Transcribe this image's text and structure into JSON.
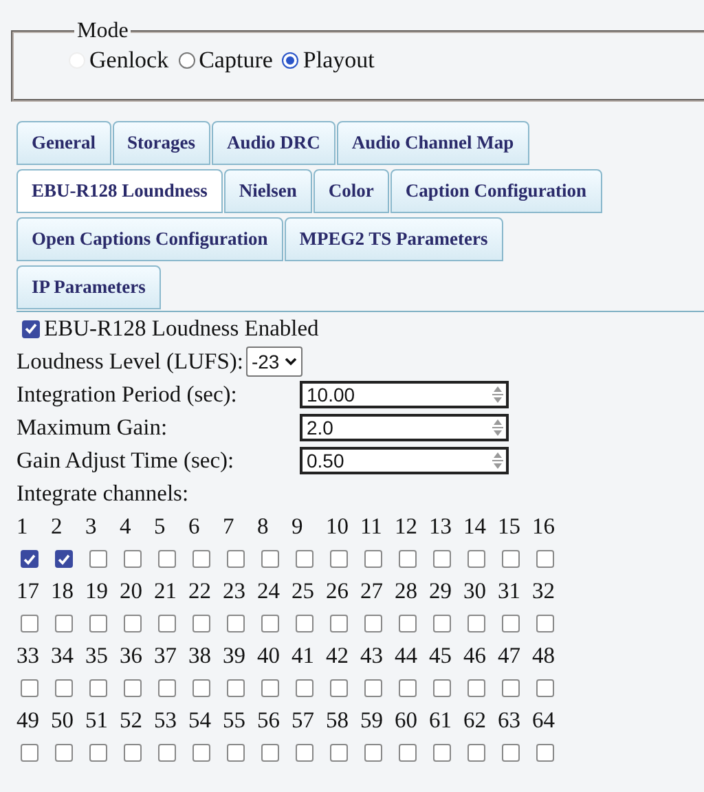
{
  "mode": {
    "legend": "Mode",
    "options": [
      {
        "label": "Genlock",
        "selected": false,
        "disabled": true
      },
      {
        "label": "Capture",
        "selected": false,
        "disabled": false
      },
      {
        "label": "Playout",
        "selected": true,
        "disabled": false
      }
    ]
  },
  "tab_rows": [
    [
      {
        "label": "General",
        "selected": false
      },
      {
        "label": "Storages",
        "selected": false
      },
      {
        "label": "Audio DRC",
        "selected": false
      },
      {
        "label": "Audio Channel Map",
        "selected": false
      }
    ],
    [
      {
        "label": "EBU-R128 Loundness",
        "selected": true
      },
      {
        "label": "Nielsen",
        "selected": false
      },
      {
        "label": "Color",
        "selected": false
      },
      {
        "label": "Caption Configuration",
        "selected": false
      }
    ],
    [
      {
        "label": "Open Captions Configuration",
        "selected": false
      },
      {
        "label": "MPEG2 TS Parameters",
        "selected": false
      }
    ],
    [
      {
        "label": "IP Parameters",
        "selected": false
      }
    ]
  ],
  "enabled": {
    "label": "EBU-R128 Loudness Enabled",
    "checked": true
  },
  "fields": [
    {
      "kind": "select",
      "label": "Loudness Level (LUFS):",
      "value": "-23"
    },
    {
      "kind": "spin",
      "label": "Integration Period (sec):",
      "value": "10.00"
    },
    {
      "kind": "spin",
      "label": "Maximum Gain:",
      "value": "2.0"
    },
    {
      "kind": "spin",
      "label": "Gain Adjust Time (sec):",
      "value": "0.50"
    }
  ],
  "channels_label": "Integrate channels:",
  "channels": [
    {
      "label": "1",
      "checked": true
    },
    {
      "label": "2",
      "checked": true
    },
    {
      "label": "3",
      "checked": false
    },
    {
      "label": "4",
      "checked": false
    },
    {
      "label": "5",
      "checked": false
    },
    {
      "label": "6",
      "checked": false
    },
    {
      "label": "7",
      "checked": false
    },
    {
      "label": "8",
      "checked": false
    },
    {
      "label": "9",
      "checked": false
    },
    {
      "label": "10",
      "checked": false
    },
    {
      "label": "11",
      "checked": false
    },
    {
      "label": "12",
      "checked": false
    },
    {
      "label": "13",
      "checked": false
    },
    {
      "label": "14",
      "checked": false
    },
    {
      "label": "15",
      "checked": false
    },
    {
      "label": "16",
      "checked": false
    },
    {
      "label": "17",
      "checked": false
    },
    {
      "label": "18",
      "checked": false
    },
    {
      "label": "19",
      "checked": false
    },
    {
      "label": "20",
      "checked": false
    },
    {
      "label": "21",
      "checked": false
    },
    {
      "label": "22",
      "checked": false
    },
    {
      "label": "23",
      "checked": false
    },
    {
      "label": "24",
      "checked": false
    },
    {
      "label": "25",
      "checked": false
    },
    {
      "label": "26",
      "checked": false
    },
    {
      "label": "27",
      "checked": false
    },
    {
      "label": "28",
      "checked": false
    },
    {
      "label": "29",
      "checked": false
    },
    {
      "label": "30",
      "checked": false
    },
    {
      "label": "31",
      "checked": false
    },
    {
      "label": "32",
      "checked": false
    },
    {
      "label": "33",
      "checked": false
    },
    {
      "label": "34",
      "checked": false
    },
    {
      "label": "35",
      "checked": false
    },
    {
      "label": "36",
      "checked": false
    },
    {
      "label": "37",
      "checked": false
    },
    {
      "label": "38",
      "checked": false
    },
    {
      "label": "39",
      "checked": false
    },
    {
      "label": "40",
      "checked": false
    },
    {
      "label": "41",
      "checked": false
    },
    {
      "label": "42",
      "checked": false
    },
    {
      "label": "43",
      "checked": false
    },
    {
      "label": "44",
      "checked": false
    },
    {
      "label": "45",
      "checked": false
    },
    {
      "label": "46",
      "checked": false
    },
    {
      "label": "47",
      "checked": false
    },
    {
      "label": "48",
      "checked": false
    },
    {
      "label": "49",
      "checked": false
    },
    {
      "label": "50",
      "checked": false
    },
    {
      "label": "51",
      "checked": false
    },
    {
      "label": "52",
      "checked": false
    },
    {
      "label": "53",
      "checked": false
    },
    {
      "label": "54",
      "checked": false
    },
    {
      "label": "55",
      "checked": false
    },
    {
      "label": "56",
      "checked": false
    },
    {
      "label": "57",
      "checked": false
    },
    {
      "label": "58",
      "checked": false
    },
    {
      "label": "59",
      "checked": false
    },
    {
      "label": "60",
      "checked": false
    },
    {
      "label": "61",
      "checked": false
    },
    {
      "label": "62",
      "checked": false
    },
    {
      "label": "63",
      "checked": false
    },
    {
      "label": "64",
      "checked": false
    }
  ]
}
